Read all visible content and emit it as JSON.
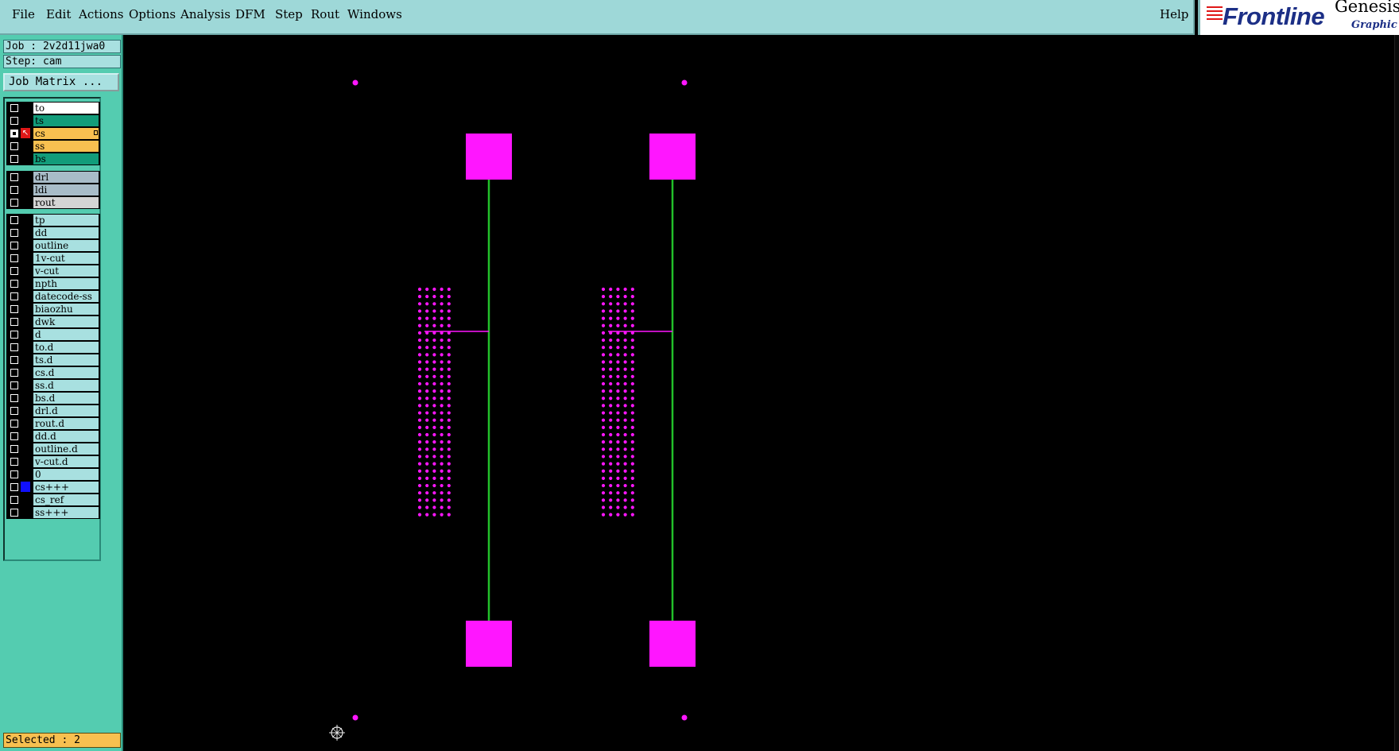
{
  "menubar": {
    "items": [
      "File",
      "Edit",
      "Actions",
      "Options",
      "Analysis",
      "DFM",
      "Step",
      "Rout",
      "Windows"
    ],
    "help": "Help"
  },
  "brand": {
    "logo": "Frontline",
    "product": "Genesis",
    "subtitle": "Graphic E"
  },
  "job": {
    "job_label": "Job : 2v2d11jwa0",
    "step_label": "Step: cam",
    "matrix_button": "Job Matrix ..."
  },
  "colors": {
    "menubar_bg": "#9ed8d8",
    "panel_bg": "#54ccb0",
    "canvas_bg": "#000000",
    "feature_magenta": "#ff16ff",
    "trace_green": "#22c02a",
    "selected_bg": "#f8c050"
  },
  "layers": {
    "board_group": [
      {
        "name": "to",
        "color": "#ffffff"
      },
      {
        "name": "ts",
        "color": "#129c7a"
      },
      {
        "name": "cs",
        "color": "#f8c050",
        "active": true
      },
      {
        "name": "ss",
        "color": "#f8c050"
      },
      {
        "name": "bs",
        "color": "#129c7a"
      }
    ],
    "drill_group": [
      {
        "name": "drl",
        "color": "#a8bcc8"
      },
      {
        "name": "ldi",
        "color": "#a8bcc8"
      },
      {
        "name": "rout",
        "color": "#d4d4d4"
      }
    ],
    "misc_group": [
      {
        "name": "tp"
      },
      {
        "name": "dd"
      },
      {
        "name": "outline"
      },
      {
        "name": "1v-cut"
      },
      {
        "name": "v-cut"
      },
      {
        "name": "npth"
      },
      {
        "name": "datecode-ss"
      },
      {
        "name": "biaozhu"
      },
      {
        "name": "dwk"
      },
      {
        "name": "d"
      },
      {
        "name": "to.d"
      },
      {
        "name": "ts.d"
      },
      {
        "name": "cs.d"
      },
      {
        "name": "ss.d"
      },
      {
        "name": "bs.d"
      },
      {
        "name": "drl.d"
      },
      {
        "name": "rout.d"
      },
      {
        "name": "dd.d"
      },
      {
        "name": "outline.d"
      },
      {
        "name": "v-cut.d"
      },
      {
        "name": "0"
      },
      {
        "name": "cs+++",
        "marker": "blue"
      },
      {
        "name": "cs_ref"
      },
      {
        "name": "ss+++"
      }
    ]
  },
  "status": {
    "selected_label": "Selected : 2"
  },
  "icons": {
    "snap_cursor": "crosshair-snap-icon",
    "work_layer": "work-layer-arrow-icon"
  }
}
